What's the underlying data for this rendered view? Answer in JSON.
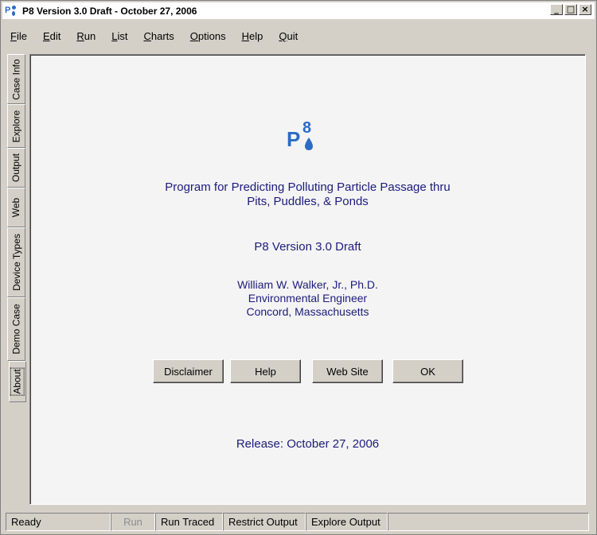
{
  "window": {
    "title": "P8 Version 3.0 Draft - October 27, 2006",
    "controls": {
      "minimize": "_",
      "maximize": "□",
      "close": "×"
    }
  },
  "menu": [
    {
      "u": "F",
      "rest": "ile"
    },
    {
      "u": "E",
      "rest": "dit"
    },
    {
      "u": "R",
      "rest": "un"
    },
    {
      "u": "L",
      "rest": "ist"
    },
    {
      "u": "C",
      "rest": "harts"
    },
    {
      "u": "O",
      "rest": "ptions"
    },
    {
      "u": "H",
      "rest": "elp"
    },
    {
      "u": "Q",
      "rest": "uit"
    }
  ],
  "tabs": [
    "Case Info",
    "Explore",
    "Output",
    "Web",
    "Device Types",
    "Demo Case",
    "About"
  ],
  "active_tab": "About",
  "about": {
    "logo_letter": "P",
    "logo_number": "8",
    "program_line1": "Program for Predicting Polluting Particle Passage thru",
    "program_line2": "Pits, Puddles, & Ponds",
    "version": "P8 Version 3.0 Draft",
    "author_name": "William W. Walker, Jr., Ph.D.",
    "author_title": "Environmental Engineer",
    "author_location": "Concord, Massachusetts",
    "buttons": {
      "disclaimer": "Disclaimer",
      "help": "Help",
      "website": "Web Site",
      "ok": "OK"
    },
    "release": "Release: October 27, 2006",
    "text_color": "#1c1c7c",
    "logo_color": "#2b6cc4"
  },
  "status": {
    "ready": "Ready",
    "run": "Run",
    "run_traced": "Run Traced",
    "restrict_output": "Restrict Output",
    "explore_output": "Explore Output"
  }
}
